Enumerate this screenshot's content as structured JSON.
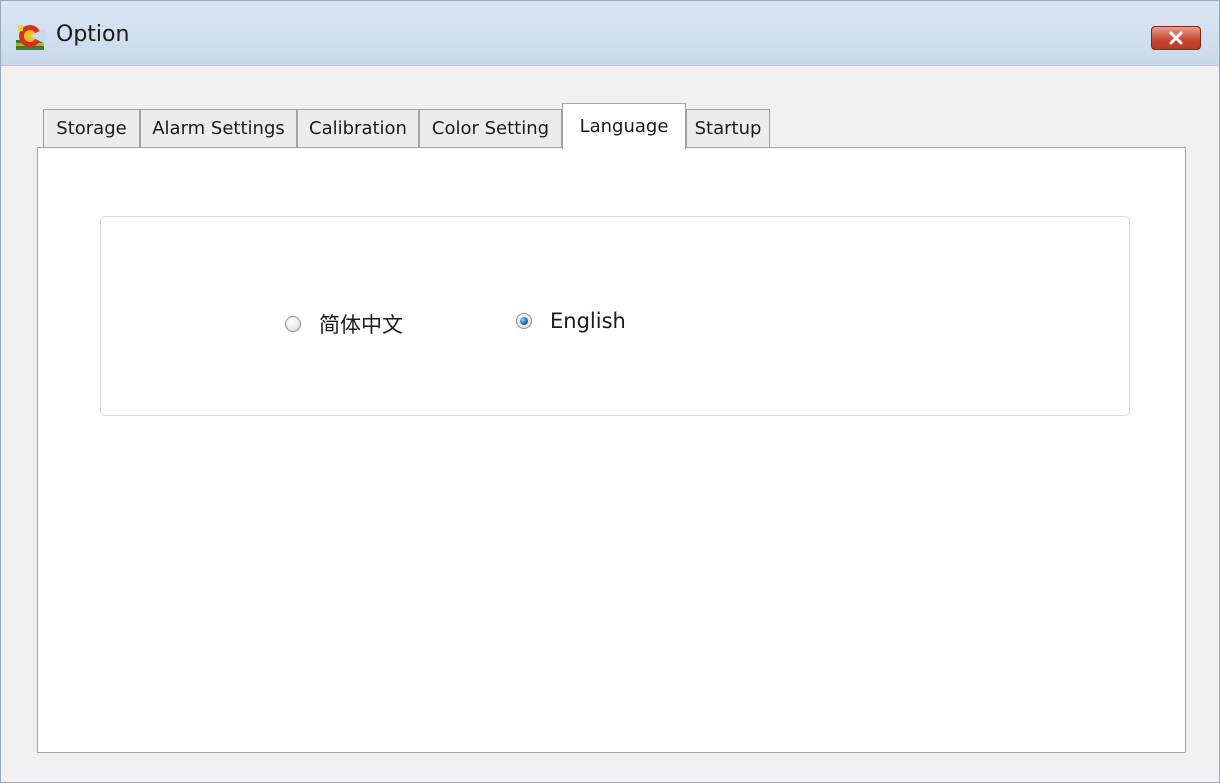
{
  "window": {
    "title": "Option"
  },
  "tabs": [
    {
      "label": "Storage",
      "active": false
    },
    {
      "label": "Alarm Settings",
      "active": false
    },
    {
      "label": "Calibration",
      "active": false
    },
    {
      "label": "Color Setting",
      "active": false
    },
    {
      "label": "Language",
      "active": true
    },
    {
      "label": "Startup",
      "active": false
    }
  ],
  "language": {
    "options": [
      {
        "label": "简体中文",
        "checked": false
      },
      {
        "label": "English",
        "checked": true
      }
    ]
  },
  "icons": {
    "app": "app-logo-icon",
    "close": "close-icon"
  },
  "colors": {
    "close_button": "#c84a35",
    "radio_selected": "#1a5fb4"
  }
}
